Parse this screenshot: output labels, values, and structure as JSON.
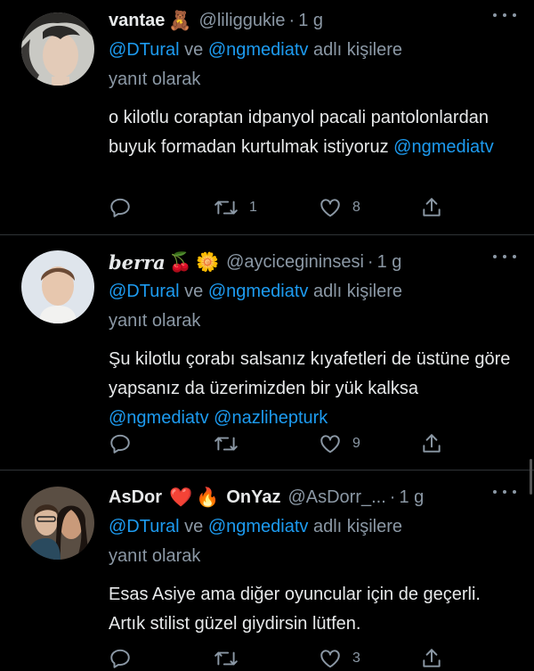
{
  "tweets": [
    {
      "name": "vantae",
      "name_emojis": [
        "🧸"
      ],
      "handle": "@liliggukie",
      "dot": "·",
      "time": "1 g",
      "reply_mentions": [
        "@DTural",
        "@ngmediatv"
      ],
      "reply_ve": " ve ",
      "reply_suffix": " adlı kişilere",
      "reply_suffix2": "yanıt olarak",
      "body_text": "o kilotlu coraptan idpanyol pacali pantolonlardan buyuk formadan kurtulmak istiyoruz ",
      "body_mentions": [
        "@ngmediatv"
      ],
      "retweets": "1",
      "likes": "8"
    },
    {
      "name": "berra",
      "name_emojis": [
        "🍒",
        "🌼"
      ],
      "handle": "@aycicegininsesi",
      "dot": "·",
      "time": "1 g",
      "reply_mentions": [
        "@DTural",
        "@ngmediatv"
      ],
      "reply_ve": " ve ",
      "reply_suffix": " adlı kişilere",
      "reply_suffix2": "yanıt olarak",
      "body_text": "Şu kilotlu çorabı salsanız kıyafetleri de üstüne göre yapsanız da üzerimizden bir yük kalksa ",
      "body_mentions": [
        "@ngmediatv",
        "@nazlihepturk"
      ],
      "retweets": "",
      "likes": "9"
    },
    {
      "name": "AsDor",
      "name_emojis": [
        "❤️",
        "🔥"
      ],
      "name2": "OnYaz",
      "handle": "@AsDorr_...",
      "dot": "·",
      "time": "1 g",
      "reply_mentions": [
        "@DTural",
        "@ngmediatv"
      ],
      "reply_ve": " ve ",
      "reply_suffix": " adlı kişilere",
      "reply_suffix2": "yanıt olarak",
      "body_text": "Esas Asiye ama diğer oyuncular için de geçerli. Artık stilist güzel giydirsin lütfen.",
      "body_mentions": [],
      "retweets": "",
      "likes": "3"
    }
  ],
  "colors": {
    "background": "#000000",
    "text": "#e7e9ea",
    "secondary": "#8b98a5",
    "mention": "#1d9bf0",
    "divider": "#2f3336"
  },
  "icons": [
    "reply-icon",
    "retweet-icon",
    "like-icon",
    "share-icon",
    "more-icon"
  ]
}
